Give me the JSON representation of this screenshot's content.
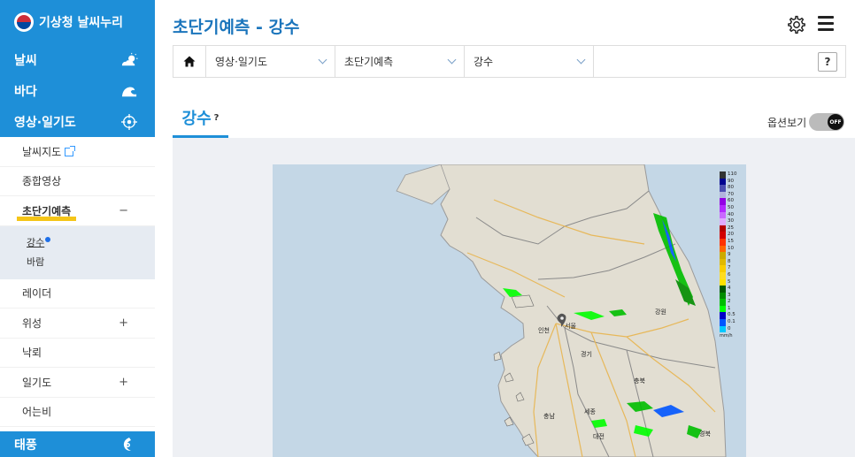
{
  "logo": {
    "text": "기상청 날씨누리"
  },
  "sidebar": {
    "main_items": [
      {
        "label": "날씨",
        "icon": "cloud-sun-icon"
      },
      {
        "label": "바다",
        "icon": "wave-icon"
      },
      {
        "label": "영상·일기도",
        "icon": "satellite-target-icon"
      }
    ],
    "sub_items": [
      {
        "label": "날씨지도",
        "mark": ""
      },
      {
        "label": "종합영상",
        "mark": ""
      },
      {
        "label": "초단기예측",
        "mark": "−"
      }
    ],
    "sub_panel": [
      {
        "label": "강수"
      },
      {
        "label": "바람"
      }
    ],
    "sub_items_after": [
      {
        "label": "레이더",
        "mark": ""
      },
      {
        "label": "위성",
        "mark": "+"
      },
      {
        "label": "낙뢰",
        "mark": ""
      },
      {
        "label": "일기도",
        "mark": "+"
      },
      {
        "label": "어는비",
        "mark": ""
      }
    ],
    "bottom_item": {
      "label": "태풍",
      "icon": "typhoon-icon"
    }
  },
  "header": {
    "title": "초단기예측 - 강수"
  },
  "breadcrumb": {
    "items": [
      "영상·일기도",
      "초단기예측",
      "강수"
    ],
    "help_label": "?"
  },
  "tab": {
    "label": "강수",
    "help": "?"
  },
  "options": {
    "label": "옵션보기",
    "toggle_state": "OFF"
  },
  "legend": {
    "levels": [
      "110",
      "90",
      "80",
      "70",
      "60",
      "50",
      "40",
      "30",
      "25",
      "20",
      "15",
      "10",
      "9",
      "8",
      "7",
      "6",
      "5",
      "4",
      "3",
      "2",
      "1",
      "0.5",
      "0.1",
      "0"
    ],
    "colors": [
      "#333333",
      "#000390",
      "#4c4eb1",
      "#b3b4de",
      "#9300e4",
      "#b329ff",
      "#c969ff",
      "#e0a9ff",
      "#b40000",
      "#d20000",
      "#ff3200",
      "#ff6600",
      "#ccaa00",
      "#e0b900",
      "#f9cd00",
      "#ffdc1f",
      "#ffe100",
      "#005a00",
      "#008c00",
      "#00be00",
      "#00ff00",
      "#0000c8",
      "#0055ff",
      "#00c8ff"
    ],
    "unit": "mm/h"
  },
  "map_labels": [
    {
      "name": "인천",
      "pos": "incheon"
    },
    {
      "name": "서울",
      "pos": "seoul"
    },
    {
      "name": "경기",
      "pos": "gyeonggi"
    },
    {
      "name": "강원",
      "pos": "gangwon"
    },
    {
      "name": "충북",
      "pos": "chungbuk"
    },
    {
      "name": "충남",
      "pos": "chungnam"
    },
    {
      "name": "세종",
      "pos": "sejong"
    },
    {
      "name": "대전",
      "pos": "daejeon"
    },
    {
      "name": "경북",
      "pos": "gyeongbuk"
    }
  ]
}
